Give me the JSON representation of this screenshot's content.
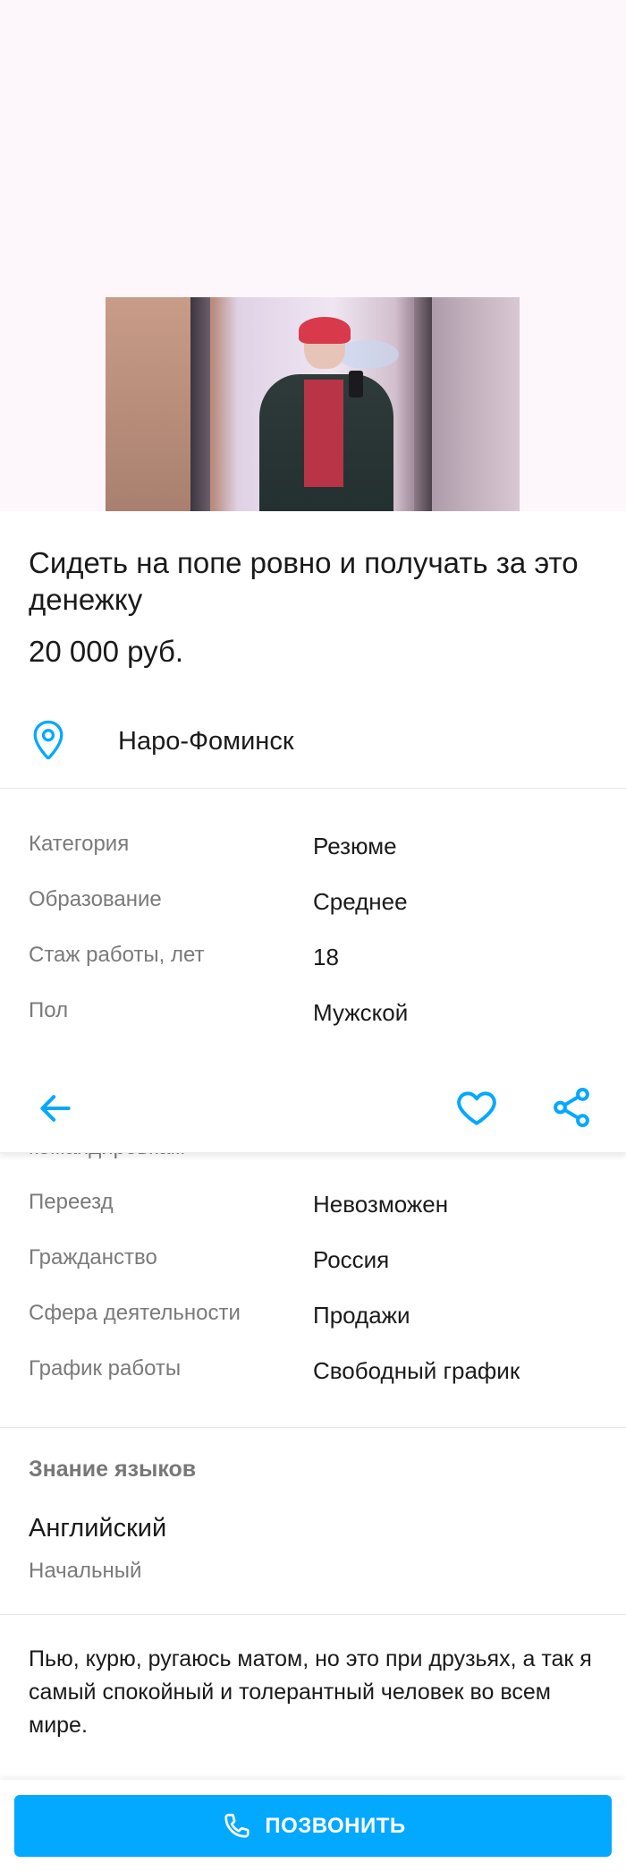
{
  "listing": {
    "title": "Сидеть на попе ровно и получать за это денежку",
    "price": "20 000 руб.",
    "location": "Наро-Фоминск",
    "location_icon": "map-pin-icon"
  },
  "properties": [
    {
      "label": "Категория",
      "value": "Резюме"
    },
    {
      "label": "Образование",
      "value": "Среднее"
    },
    {
      "label": "Стаж работы, лет",
      "value": "18"
    },
    {
      "label": "Пол",
      "value": "Мужской"
    },
    {
      "label": "Переезд",
      "value": "Невозможен"
    },
    {
      "label": "Гражданство",
      "value": "Россия"
    },
    {
      "label": "Сфера деятельности",
      "value": "Продажи"
    },
    {
      "label": "График работы",
      "value": "Свободный график"
    }
  ],
  "partially_hidden_label": "командировкам",
  "actionbar": {
    "back_icon": "arrow-left-icon",
    "favorite_icon": "heart-icon",
    "share_icon": "share-icon"
  },
  "languages": {
    "heading": "Знание языков",
    "items": [
      {
        "name": "Английский",
        "level": "Начальный"
      }
    ]
  },
  "description": "Пью, курю, ругаюсь матом, но это при друзьях, а так я самый спокойный и толерантный человек во всем мире.",
  "call_button": {
    "label": "ПОЗВОНИТЬ",
    "icon": "phone-icon"
  },
  "colors": {
    "accent": "#03a8ff",
    "gallery_background": "#fdf7fc"
  }
}
